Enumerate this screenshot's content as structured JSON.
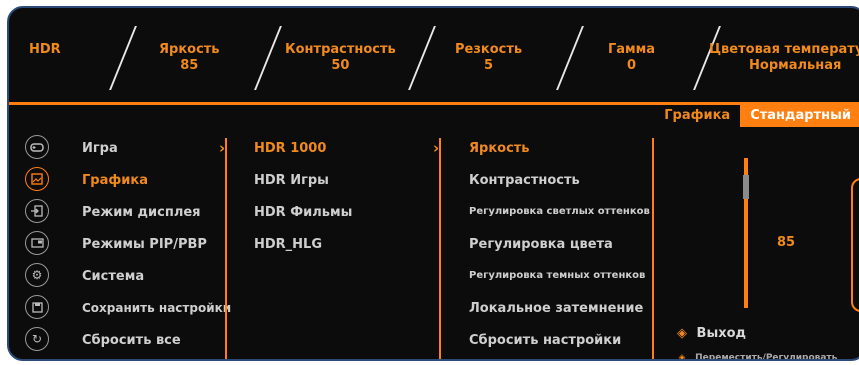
{
  "status": {
    "hdr": {
      "label": "HDR",
      "value": ""
    },
    "brightness": {
      "label": "Яркость",
      "value": "85"
    },
    "contrast": {
      "label": "Контрастность",
      "value": "50"
    },
    "sharpness": {
      "label": "Резкость",
      "value": "5"
    },
    "gamma": {
      "label": "Гамма",
      "value": "0"
    },
    "color_temp": {
      "label": "Цветовая температура",
      "value": "Нормальная"
    }
  },
  "tabs": {
    "category": "Графика",
    "preset": "Стандартный"
  },
  "main_menu": [
    {
      "label": "Игра",
      "icon": "gamepad-icon"
    },
    {
      "label": "Графика",
      "icon": "image-icon"
    },
    {
      "label": "Режим дисплея",
      "icon": "input-icon"
    },
    {
      "label": "Режимы PIP/PBP",
      "icon": "pip-icon"
    },
    {
      "label": "Система",
      "icon": "gear-icon"
    },
    {
      "label": "Сохранить настройки",
      "icon": "save-icon"
    },
    {
      "label": "Сбросить все",
      "icon": "reset-icon"
    }
  ],
  "submenu": [
    {
      "label": "HDR 1000"
    },
    {
      "label": "HDR Игры"
    },
    {
      "label": "HDR Фильмы"
    },
    {
      "label": "HDR_HLG"
    }
  ],
  "options": [
    {
      "label": "Яркость"
    },
    {
      "label": "Контрастность"
    },
    {
      "label": "Регулировка светлых оттенков"
    },
    {
      "label": "Регулировка цвета"
    },
    {
      "label": "Регулировка темных оттенков"
    },
    {
      "label": "Локальное затемнение"
    },
    {
      "label": "Сбросить настройки"
    }
  ],
  "slider": {
    "value": "85",
    "level": 0.85
  },
  "hints": {
    "exit": "Выход",
    "move": "Переместить/Регулировать"
  },
  "colors": {
    "accent": "#ff7f11",
    "background": "#0c0c0c",
    "frame": "#2c4a78"
  }
}
